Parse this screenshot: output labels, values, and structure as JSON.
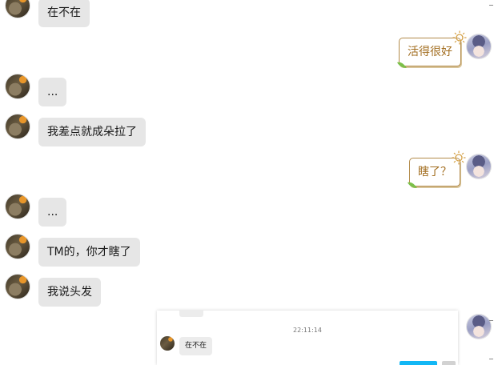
{
  "messages": [
    {
      "side": "left",
      "text": "在不在"
    },
    {
      "side": "right",
      "text": "活得很好"
    },
    {
      "side": "left",
      "text": "..."
    },
    {
      "side": "left",
      "text": "我差点就成朵拉了"
    },
    {
      "side": "right",
      "text": "瞎了？"
    },
    {
      "side": "left",
      "text": "..."
    },
    {
      "side": "left",
      "text": "TM的，你才瞎了"
    },
    {
      "side": "left",
      "text": "我说头发"
    }
  ],
  "embedded_window": {
    "timestamp": "22:11:14",
    "message": "在不在"
  },
  "colors": {
    "left_bubble": "#e6e6e6",
    "right_bubble_border": "#b38b4a",
    "right_bubble_text": "#a26d1f",
    "send_button": "#12b7f5"
  },
  "icons": [
    "contact-avatar",
    "self-avatar",
    "sun-decoration-icon",
    "leaf-decoration-icon"
  ]
}
